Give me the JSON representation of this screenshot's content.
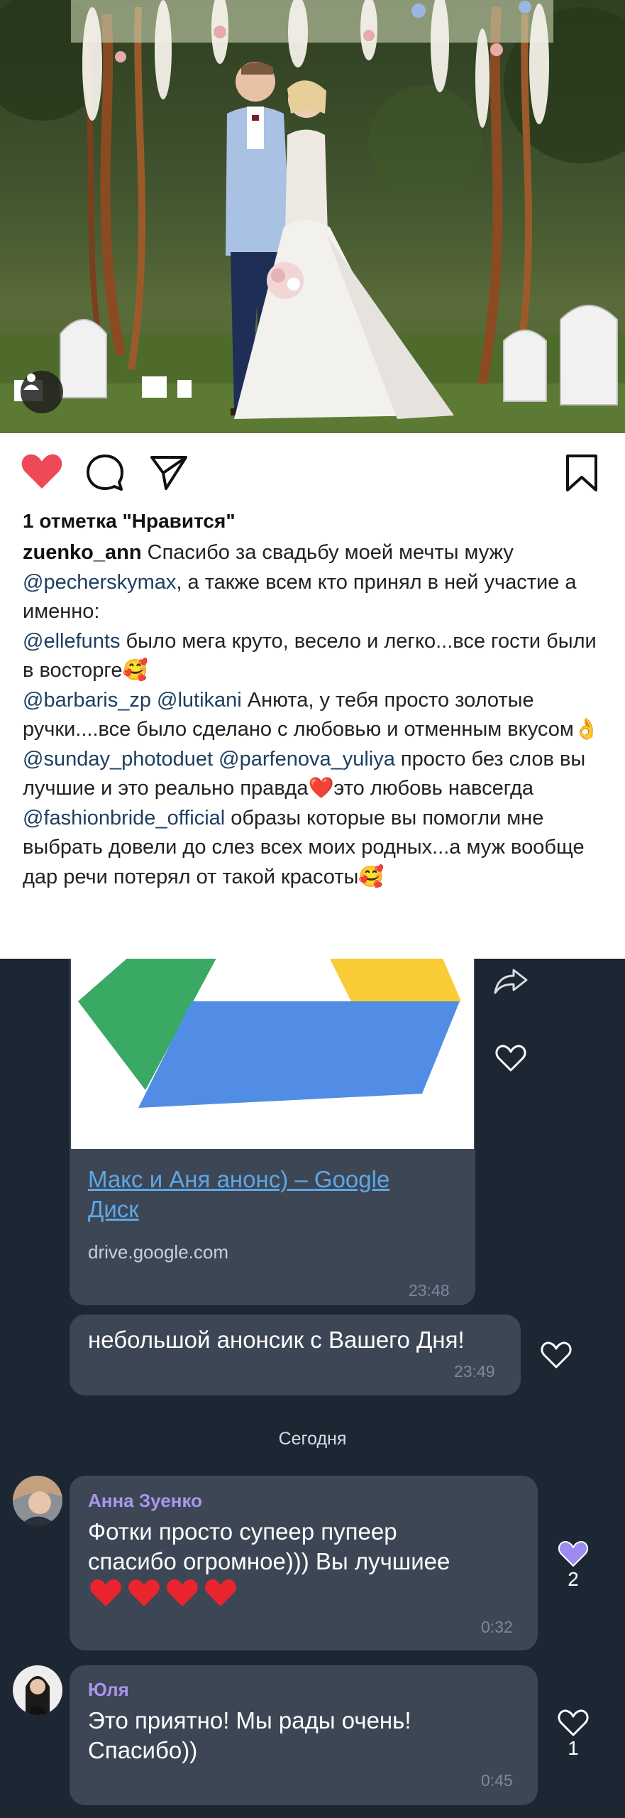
{
  "instagram": {
    "likes_text": "1 отметка \"Нравится\"",
    "caption": {
      "username": "zuenko_ann",
      "segments": [
        {
          "text": " Спасибо за свадьбу моей мечты мужу ",
          "type": "text"
        },
        {
          "text": "@pecherskymax",
          "type": "mention"
        },
        {
          "text": ", а также всем кто принял в ней участие а именно:",
          "type": "text"
        },
        {
          "text": "@ellefunts",
          "type": "mention"
        },
        {
          "text": " было мега круто, весело и легко...все гости были в восторге🥰",
          "type": "text"
        },
        {
          "text": "@barbaris_zp",
          "type": "mention"
        },
        {
          "text": " ",
          "type": "text"
        },
        {
          "text": "@lutikani",
          "type": "mention"
        },
        {
          "text": " Анюта, у тебя просто золотые ручки....все было сделано с любовью и отменным вкусом👌",
          "type": "text"
        },
        {
          "text": "@sunday_photoduet",
          "type": "mention"
        },
        {
          "text": " ",
          "type": "text"
        },
        {
          "text": "@parfenova_yuliya",
          "type": "mention"
        },
        {
          "text": " просто без слов вы лучшие и это реально правда❤️это любовь навсегда",
          "type": "text"
        },
        {
          "text": "@fashionbride_official",
          "type": "mention"
        },
        {
          "text": " образы которые вы помогли мне выбрать довели до слез всех моих родных...а муж вообще дар речи потерял от такой красоты🥰",
          "type": "text"
        }
      ]
    },
    "icons": {
      "like": "heart-filled-icon",
      "comment": "comment-bubble-icon",
      "share": "paper-plane-icon",
      "save": "bookmark-icon",
      "tag": "person-icon"
    },
    "colors": {
      "like": "#ed4956",
      "mention": "#1d3f63"
    }
  },
  "chat": {
    "link_message": {
      "title": "Макс и Аня анонс) – Google Диск",
      "domain": "drive.google.com",
      "time": "23:48"
    },
    "messages": [
      {
        "text": "небольшой анонсик с Вашего Дня!",
        "time": "23:49"
      }
    ],
    "date_separator": "Сегодня",
    "incoming": [
      {
        "sender": "Анна Зуенко",
        "text": "Фотки просто супеер пупеер спасибо огромное))) Вы лучшиее",
        "hearts": 4,
        "time": "0:32",
        "likes": "2",
        "liked": true
      },
      {
        "sender": "Юля",
        "text": "Это приятно! Мы рады очень! Спасибо))",
        "time": "0:45",
        "likes": "1",
        "liked": false
      }
    ],
    "colors": {
      "background": "#1c2733",
      "bubble": "#3c4654",
      "link": "#5ea7e5",
      "sender": "#a995ee",
      "liked_heart": "#9b8cf0"
    }
  }
}
